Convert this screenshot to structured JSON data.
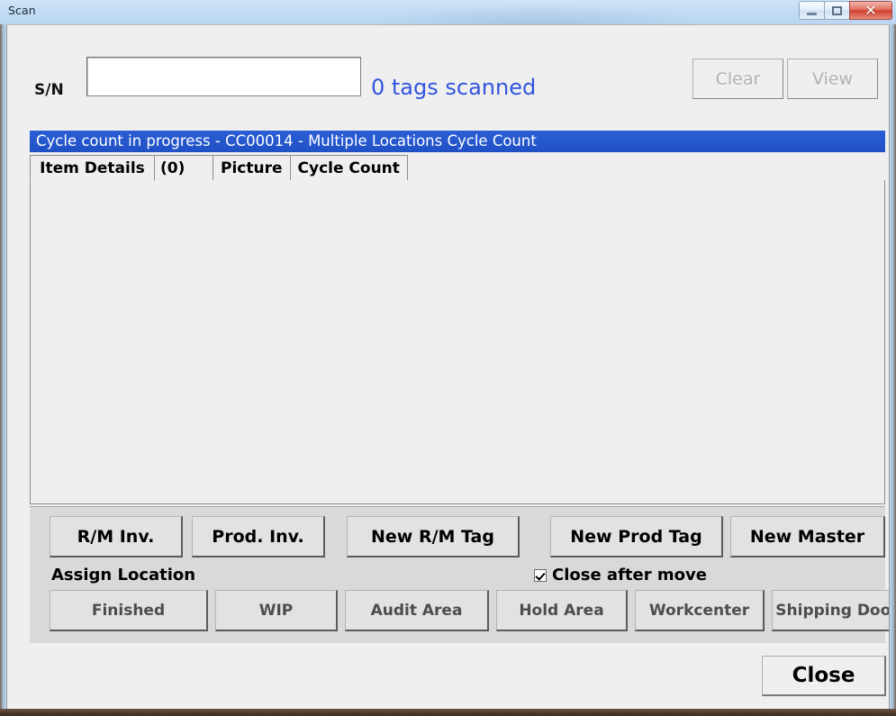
{
  "window": {
    "title": "Scan",
    "controls": {
      "minimize": "minimize-icon",
      "maximize": "restore-icon",
      "close": "✕"
    }
  },
  "scan_row": {
    "sn_label": "S/N",
    "sn_value": "",
    "sn_placeholder": "",
    "tags_scanned": "0 tags scanned",
    "tags_scanned_color": "#3355dd",
    "clear_label": "Clear",
    "view_label": "View",
    "buttons_enabled": false
  },
  "status_band": {
    "text": "Cycle count in progress - CC00014 - Multiple Locations Cycle Count",
    "background": "#2255cc",
    "color": "#ffffff"
  },
  "tabs": [
    {
      "label": "Item Details",
      "active": true
    },
    {
      "label": "(0)",
      "active": false
    },
    {
      "label": "Picture",
      "active": false
    },
    {
      "label": "Cycle Count",
      "active": false
    }
  ],
  "action_panel": {
    "row1": [
      {
        "label": "R/M Inv."
      },
      {
        "label": "Prod. Inv."
      },
      {
        "label": "New R/M Tag"
      },
      {
        "label": "New Prod Tag"
      },
      {
        "label": "New Master"
      }
    ],
    "assign_location_label": "Assign Location",
    "close_after_move": {
      "label": "Close after move",
      "checked": true
    },
    "row2": [
      {
        "label": "Finished"
      },
      {
        "label": "WIP"
      },
      {
        "label": "Audit Area"
      },
      {
        "label": "Hold Area"
      },
      {
        "label": "Workcenter"
      },
      {
        "label": "Shipping Door"
      }
    ]
  },
  "footer": {
    "close_label": "Close"
  }
}
